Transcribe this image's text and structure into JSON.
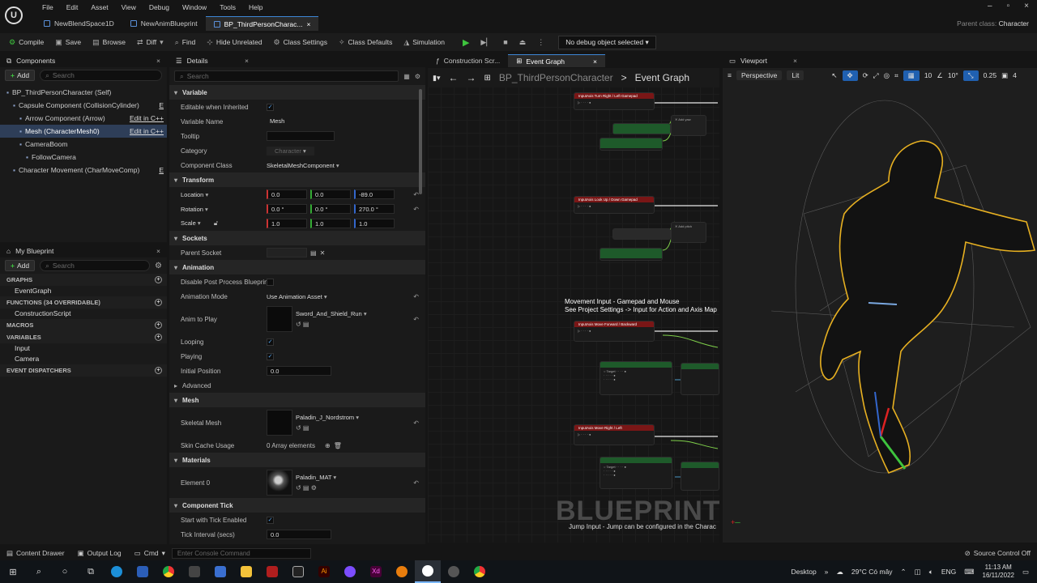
{
  "menu": [
    "File",
    "Edit",
    "Asset",
    "View",
    "Debug",
    "Window",
    "Tools",
    "Help"
  ],
  "tabs": [
    {
      "label": "NewBlendSpace1D",
      "active": false
    },
    {
      "label": "NewAnimBlueprint",
      "active": false
    },
    {
      "label": "BP_ThirdPersonCharac...",
      "active": true
    }
  ],
  "parent_class": {
    "label": "Parent class:",
    "value": "Character"
  },
  "toolbar": {
    "compile": "Compile",
    "save": "Save",
    "browse": "Browse",
    "diff": "Diff",
    "find": "Find",
    "hide_unrelated": "Hide Unrelated",
    "class_settings": "Class Settings",
    "class_defaults": "Class Defaults",
    "simulation": "Simulation",
    "debug_object": "No debug object selected"
  },
  "components": {
    "title": "Components",
    "add": "Add",
    "search_placeholder": "Search",
    "items": [
      {
        "label": "BP_ThirdPersonCharacter (Self)",
        "depth": 0
      },
      {
        "label": "Capsule Component (CollisionCylinder)",
        "depth": 1,
        "edit": "E"
      },
      {
        "label": "Arrow Component (Arrow)",
        "depth": 2,
        "edit": "Edit in C++"
      },
      {
        "label": "Mesh (CharacterMesh0)",
        "depth": 2,
        "edit": "Edit in C++",
        "selected": true
      },
      {
        "label": "CameraBoom",
        "depth": 2
      },
      {
        "label": "FollowCamera",
        "depth": 3
      },
      {
        "label": "Character Movement (CharMoveComp)",
        "depth": 1,
        "edit": "E"
      }
    ]
  },
  "my_blueprint": {
    "title": "My Blueprint",
    "add": "Add",
    "search_placeholder": "Search",
    "sections": [
      {
        "label": "GRAPHS",
        "items": [
          "EventGraph"
        ]
      },
      {
        "label": "FUNCTIONS (34 OVERRIDABLE)",
        "items": [
          "ConstructionScript"
        ]
      },
      {
        "label": "MACROS",
        "items": []
      },
      {
        "label": "VARIABLES",
        "items": [
          "Input",
          "Camera"
        ]
      },
      {
        "label": "EVENT DISPATCHERS",
        "items": []
      }
    ]
  },
  "details": {
    "title": "Details",
    "search_placeholder": "Search",
    "variable": {
      "cat": "Variable",
      "editable": "Editable when Inherited",
      "var_name_lbl": "Variable Name",
      "var_name": "Mesh",
      "tooltip": "Tooltip",
      "category_lbl": "Category",
      "category": "Character",
      "comp_class_lbl": "Component Class",
      "comp_class": "SkeletalMeshComponent"
    },
    "transform": {
      "cat": "Transform",
      "location": "Location",
      "rotation": "Rotation",
      "scale": "Scale",
      "loc": [
        "0.0",
        "0.0",
        "-89.0"
      ],
      "rot": [
        "0.0 °",
        "0.0 °",
        "270.0 °"
      ],
      "scl": [
        "1.0",
        "1.0",
        "1.0"
      ]
    },
    "sockets": {
      "cat": "Sockets",
      "parent_socket": "Parent Socket"
    },
    "animation": {
      "cat": "Animation",
      "disable_post": "Disable Post Process Blueprint",
      "mode_lbl": "Animation Mode",
      "mode": "Use Animation Asset",
      "anim_lbl": "Anim to Play",
      "anim": "Sword_And_Shield_Run",
      "looping": "Looping",
      "playing": "Playing",
      "init_pos_lbl": "Initial Position",
      "init_pos": "0.0",
      "advanced": "Advanced"
    },
    "mesh": {
      "cat": "Mesh",
      "skel_lbl": "Skeletal Mesh",
      "skel": "Paladin_J_Nordstrom",
      "skin_lbl": "Skin Cache Usage",
      "skin": "0 Array elements"
    },
    "materials": {
      "cat": "Materials",
      "el_lbl": "Element 0",
      "el": "Paladin_MAT"
    },
    "tick": {
      "cat": "Component Tick",
      "start": "Start with Tick Enabled",
      "interval_lbl": "Tick Interval (secs)",
      "interval": "0.0"
    }
  },
  "graph": {
    "tab_construction": "Construction Scr...",
    "tab_event": "Event Graph",
    "breadcrumb_bp": "BP_ThirdPersonCharacter",
    "breadcrumb_graph": "Event Graph",
    "comment1_line1": "Movement Input - Gamepad and Mouse",
    "comment1_line2": "See Project Settings -> Input for Action and Axis Map",
    "comment2": "Jump Input - Jump can be configured in the Charac",
    "watermark": "BLUEPRINT",
    "nodes": [
      {
        "title": "InputAxis Turn Right / Left Gamepad"
      },
      {
        "title": "InputAxis Look Up / Down Gamepad"
      },
      {
        "title": "InputAxis Move Forward / Backward"
      },
      {
        "title": "InputAxis Move Right / Left"
      }
    ]
  },
  "viewport": {
    "title": "Viewport",
    "perspective": "Perspective",
    "lit": "Lit",
    "grid": "10",
    "angle": "10°",
    "scale": "0.25",
    "cams": "4"
  },
  "status": {
    "content_drawer": "Content Drawer",
    "output_log": "Output Log",
    "cmd": "Cmd",
    "console_placeholder": "Enter Console Command",
    "source_control": "Source Control Off"
  },
  "taskbar": {
    "desktop": "Desktop",
    "weather": "29°C Có mây",
    "lang": "ENG",
    "time": "11:13 AM",
    "date": "16/11/2022"
  }
}
